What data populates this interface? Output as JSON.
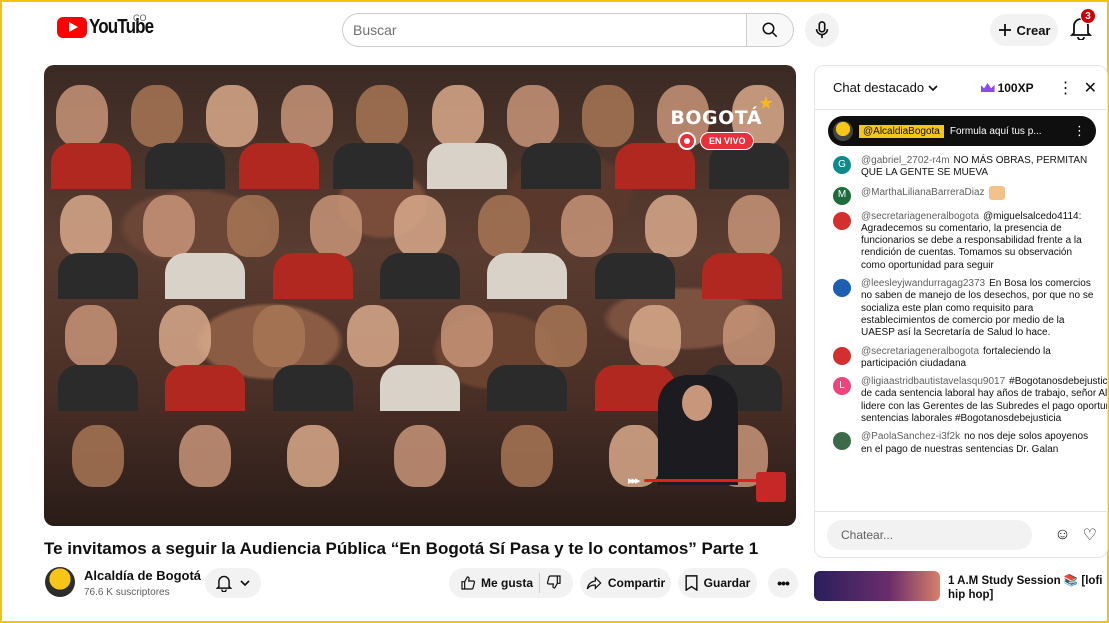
{
  "header": {
    "logo_text": "YouTube",
    "country_code": "CO",
    "search_placeholder": "Buscar",
    "create_label": "Crear",
    "notification_count": "3"
  },
  "video": {
    "brand": "BOGOTÁ",
    "live_label": "EN VIVO",
    "title": "Te invitamos a seguir la Audiencia Pública “En Bogotá Sí Pasa y te lo contamos” Parte 1"
  },
  "channel": {
    "name": "Alcaldía de Bogotá",
    "subscribers": "76.6 K suscriptores"
  },
  "actions": {
    "like_label": "Me gusta",
    "share_label": "Compartir",
    "save_label": "Guardar"
  },
  "chat": {
    "header_title": "Chat destacado",
    "xp_label": "100XP",
    "pinned": {
      "author": "@AlcaldiaBogota",
      "message": "Formula aquí tus p..."
    },
    "messages": [
      {
        "initial": "G",
        "color": "#0f8a8a",
        "author": "@gabriel_2702-r4m",
        "text": "NO MÁS OBRAS, PERMITAN QUE LA GENTE SE MUEVA"
      },
      {
        "initial": "M",
        "color": "#1e6b3c",
        "author": "@MarthaLilianaBarreraDiaz",
        "text": ""
      },
      {
        "initial": "",
        "color": "#d32f2f",
        "author": "@secretariageneralbogota",
        "text": "@miguelsalcedo4114: Agradecemos su comentario, la presencia de funcionarios se debe a responsabilidad frente a la rendición de cuentas. Tomamos su observación como oportunidad para seguir"
      },
      {
        "initial": "",
        "color": "#1d5fb0",
        "author": "@leesleyjwandurragag2373",
        "text": "En Bosa los comercios no saben de manejo de los desechos, por que no se socializa este plan como requisito para establecimientos de comercio por medio de la UAESP así la Secretaría de Salud lo hace."
      },
      {
        "initial": "",
        "color": "#d32f2f",
        "author": "@secretariageneralbogota",
        "text": "fortaleciendo la participación ciudadana"
      },
      {
        "initial": "L",
        "color": "#e8467c",
        "author": "@ligiaastridbautistavelasqu9017",
        "text": "#Bogotanosdebejusticia.Detrás de cada sentencia laboral hay años de trabajo, señor Alcalde lidere con las Gerentes de las Subredes el pago oportuno de las sentencias laborales #Bogotanosdebejusticia"
      },
      {
        "initial": "",
        "color": "#3d6b4a",
        "author": "@PaolaSanchez-i3f2k",
        "text": "no nos deje solos apoyenos en el pago de nuestras sentencias Dr. Galan"
      }
    ],
    "input_placeholder": "Chatear..."
  },
  "recommendation": {
    "title": "1 A.M Study Session 📚 [lofi hip hop]"
  }
}
